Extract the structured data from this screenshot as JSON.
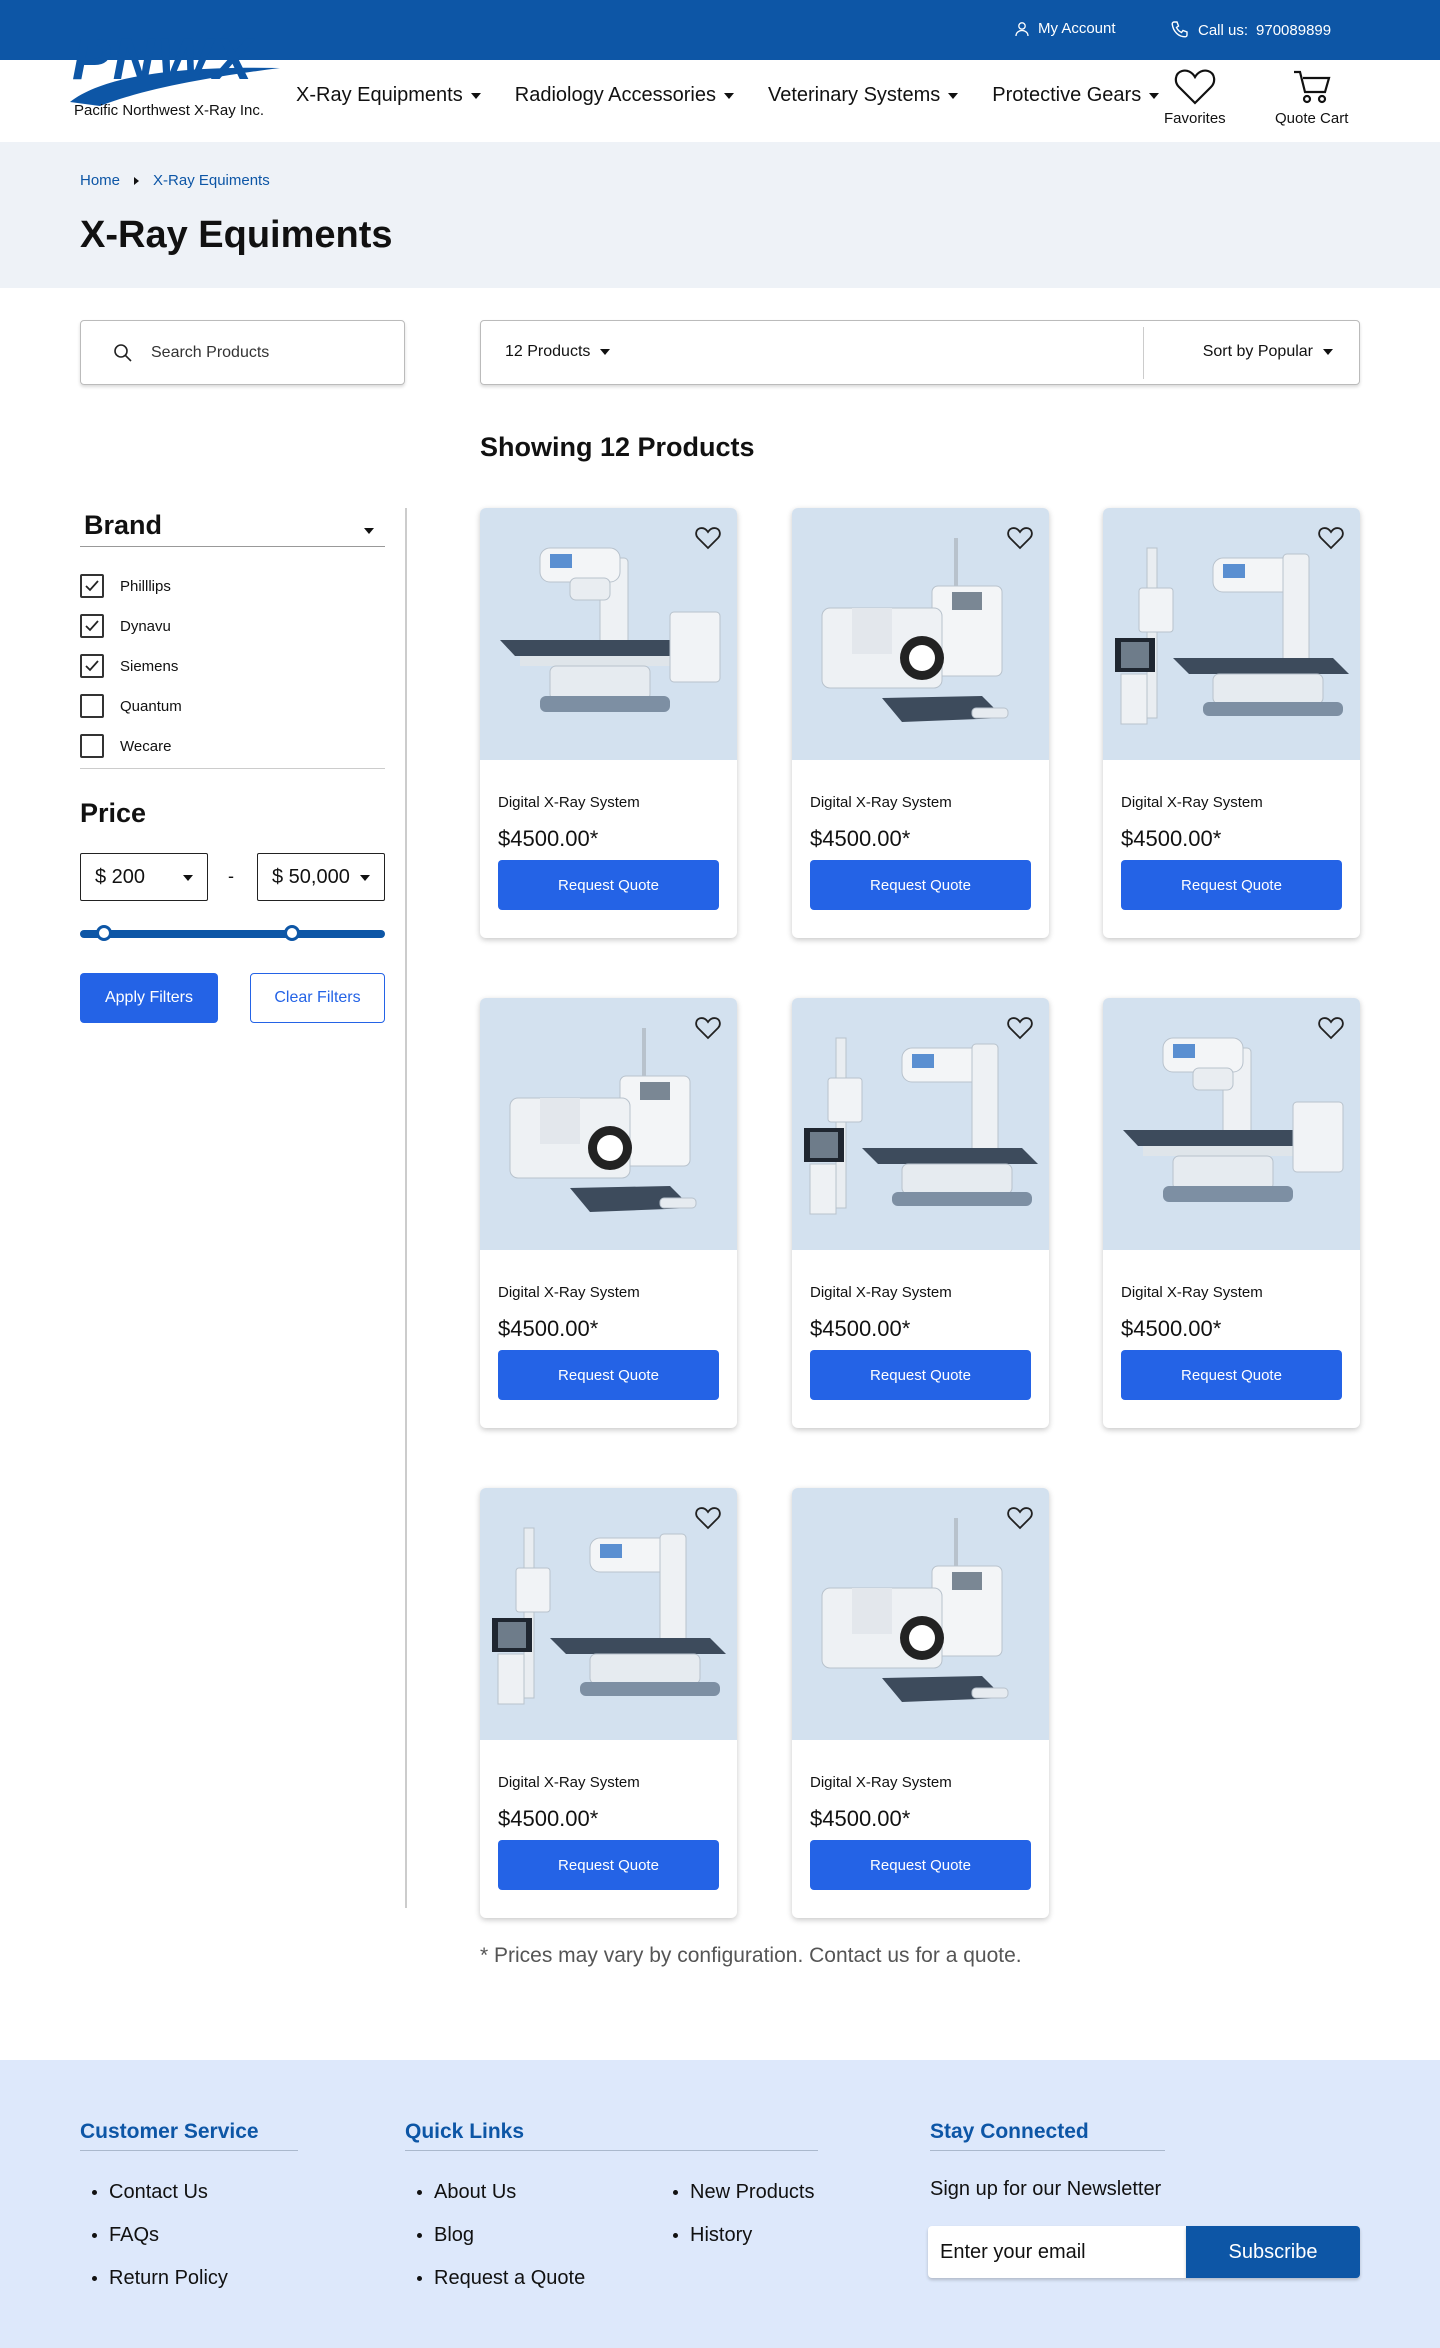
{
  "topbar": {
    "account_label": "My Account",
    "call_label": "Call us:",
    "call_number": "970089899",
    "account_icon": "user-icon",
    "phone_icon": "phone-icon"
  },
  "header": {
    "logo_text": "PNWX",
    "logo_subtitle": "Pacific Northwest X-Ray Inc.",
    "nav": [
      {
        "label": "X-Ray Equipments"
      },
      {
        "label": "Radiology Accessories"
      },
      {
        "label": "Veterinary Systems"
      },
      {
        "label": "Protective Gears"
      }
    ],
    "favorites_label": "Favorites",
    "quote_cart_label": "Quote Cart"
  },
  "breadcrumb": {
    "home": "Home",
    "current": "X-Ray Equiments"
  },
  "page_title": "X-Ray Equiments",
  "search": {
    "placeholder": "Search  Products"
  },
  "toolbar": {
    "count_label": "12  Products",
    "sort_label": "Sort by Popular"
  },
  "showing_label": "Showing 12  Products",
  "filters": {
    "brand_title": "Brand",
    "brands": [
      {
        "label": "Philllips",
        "checked": true
      },
      {
        "label": "Dynavu",
        "checked": true
      },
      {
        "label": "Siemens",
        "checked": true
      },
      {
        "label": "Quantum",
        "checked": false
      },
      {
        "label": "Wecare",
        "checked": false
      }
    ],
    "price_title": "Price",
    "price_min": "$ 200",
    "price_max": "$ 50,000",
    "price_separator": "-",
    "apply_label": "Apply Filters",
    "clear_label": "Clear Filters"
  },
  "products": [
    {
      "name": "Digital X-Ray System",
      "price": "$4500.00*",
      "cta": "Request Quote",
      "variant": "a"
    },
    {
      "name": "Digital X-Ray System",
      "price": "$4500.00*",
      "cta": "Request Quote",
      "variant": "b"
    },
    {
      "name": "Digital X-Ray System",
      "price": "$4500.00*",
      "cta": "Request Quote",
      "variant": "c"
    },
    {
      "name": "Digital X-Ray System",
      "price": "$4500.00*",
      "cta": "Request Quote",
      "variant": "b"
    },
    {
      "name": "Digital X-Ray System",
      "price": "$4500.00*",
      "cta": "Request Quote",
      "variant": "c"
    },
    {
      "name": "Digital X-Ray System",
      "price": "$4500.00*",
      "cta": "Request Quote",
      "variant": "a"
    },
    {
      "name": "Digital X-Ray System",
      "price": "$4500.00*",
      "cta": "Request Quote",
      "variant": "c"
    },
    {
      "name": "Digital X-Ray System",
      "price": "$4500.00*",
      "cta": "Request Quote",
      "variant": "b"
    }
  ],
  "disclaimer": "* Prices may vary by configuration. Contact us for a quote.",
  "footer": {
    "customer_service_title": "Customer Service",
    "customer_service": [
      "Contact Us",
      "FAQs",
      "Return Policy"
    ],
    "quick_links_title": "Quick Links",
    "quick_links_col1": [
      "About Us",
      "Blog",
      "Request a Quote"
    ],
    "quick_links_col2": [
      "New Products",
      "History"
    ],
    "stay_connected_title": "Stay Connected",
    "newsletter_label": "Sign up for our Newsletter",
    "email_placeholder": "Enter your email",
    "subscribe_label": "Subscribe"
  },
  "colors": {
    "brand_blue": "#0d56a6",
    "button_blue": "#2463e6",
    "card_image_bg": "#d3e1ef",
    "footer_bg": "#dde8fb",
    "title_band_bg": "#eef2f7"
  }
}
